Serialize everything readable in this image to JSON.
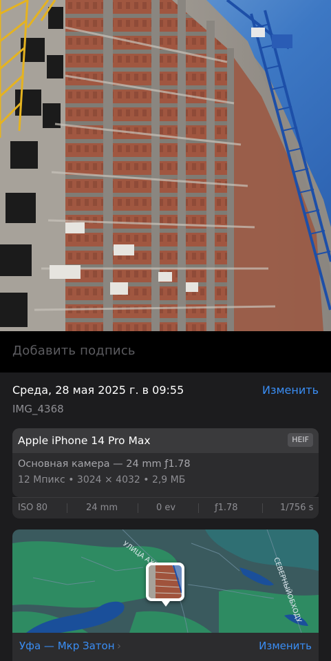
{
  "photo": {
    "icon": "construction-photo"
  },
  "caption": {
    "placeholder": "Добавить подпись"
  },
  "info": {
    "date": "Среда, 28 мая 2025 г. в 09:55",
    "edit_label": "Изменить",
    "filename": "IMG_4368"
  },
  "device": {
    "name": "Apple iPhone 14 Pro Max",
    "format_badge": "HEIF",
    "camera": "Основная камера — 24 mm ƒ1.78",
    "specs": "12 Мпикс • 3024 × 4032 • 2,9 МБ"
  },
  "exif": {
    "iso": "ISO 80",
    "focal": "24 mm",
    "ev": "0 ev",
    "aperture": "ƒ1.78",
    "shutter": "1/756 s"
  },
  "map": {
    "street_labels": [
      "УЛИЦА АХМЕ",
      "СЕВЕРНЫЙОБХОДУ"
    ],
    "location": "Уфа — Мкр Затон",
    "edit_label": "Изменить"
  },
  "colors": {
    "accent": "#3a8ef5",
    "panel": "#1c1c1e",
    "card": "#2c2c2e",
    "map_green": "#2e8b62"
  }
}
